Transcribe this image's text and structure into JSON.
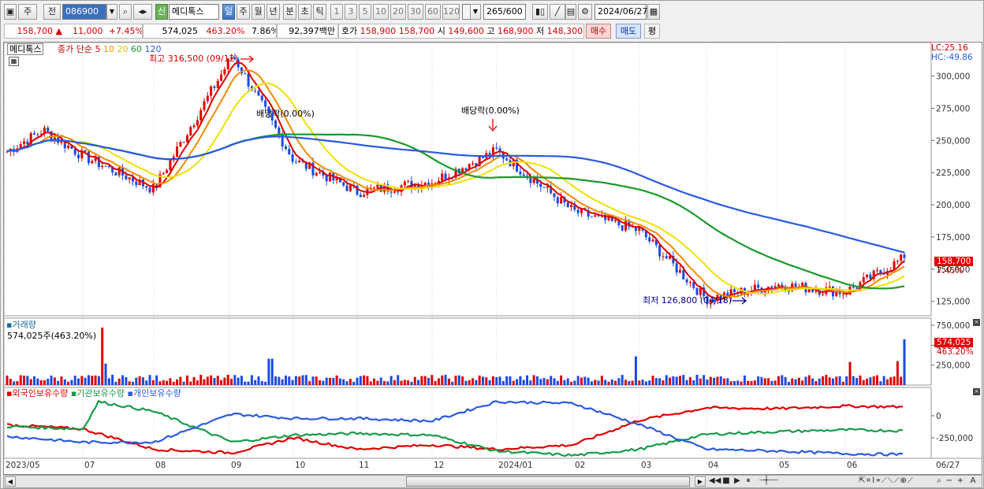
{
  "toolbar": {
    "market": "주",
    "prev": "전",
    "code": "086900",
    "shin": "신",
    "name": "메디톡스",
    "periods": [
      "일",
      "주",
      "월",
      "년",
      "분",
      "초",
      "틱"
    ],
    "active_period": "일",
    "intervals": [
      "1",
      "3",
      "5",
      "10",
      "20",
      "30",
      "60",
      "120"
    ],
    "count": "265",
    "count_max": "/600",
    "date": "2024/06/27"
  },
  "quote": {
    "price": "158,700",
    "arrow": "▲",
    "change": "11,000",
    "change_pct": "+7.45%",
    "volume": "574,025",
    "volume_pct": "463.20%",
    "turnover": "7.86%",
    "amount": "92,397백만",
    "bid_label": "호가",
    "bid": "158,900",
    "ask": "158,700",
    "open_label": "시",
    "open": "149,600",
    "high_label": "고",
    "high": "168,900",
    "low_label": "저",
    "low": "148,300",
    "buy": "매수",
    "sell": "매도",
    "flat": "평"
  },
  "chart_data": {
    "type": "line",
    "title": "메디톡스",
    "legend_price": "종가 단순 5 10 20 60 120",
    "ma_labels": [
      "5",
      "10",
      "20",
      "60",
      "120"
    ],
    "ma_colors": [
      "#e00000",
      "#f08c00",
      "#f0e000",
      "#1a9a2a",
      "#2a5ae0"
    ],
    "lc": "LC:25.16",
    "hc": "HC:-49.86",
    "y_ticks": [
      "300,000",
      "275,000",
      "250,000",
      "225,000",
      "200,000",
      "175,000",
      "150,000",
      "125,000"
    ],
    "ylim": [
      115000,
      320000
    ],
    "x_ticks": [
      "2023/05",
      "07",
      "08",
      "09",
      "10",
      "11",
      "12",
      "2024/01",
      "02",
      "03",
      "04",
      "05",
      "06",
      "06/27"
    ],
    "annotations": {
      "high": "최고 316,500 (09/12)",
      "low": "최저 126,800 (04/18)",
      "div1": "배당락(0.00%)",
      "div2": "배당락(0.00%)"
    },
    "last_price": "158,700",
    "last_pct": "7.45%",
    "price_points": [
      [
        "2023/05",
        240000
      ],
      [
        "2023/06",
        258000
      ],
      [
        "2023/07",
        238000
      ],
      [
        "2023/08",
        212000
      ],
      [
        "2023/09",
        316500
      ],
      [
        "2023/10",
        235000
      ],
      [
        "2023/11",
        210000
      ],
      [
        "2023/12",
        218000
      ],
      [
        "2024/01",
        242000
      ],
      [
        "2024/02",
        195000
      ],
      [
        "2024/03",
        180000
      ],
      [
        "2024/04",
        126800
      ],
      [
        "2024/05",
        138000
      ],
      [
        "2024/06",
        132000
      ],
      [
        "2024/06/27",
        158700
      ]
    ],
    "volume_panel": {
      "title": "거래량",
      "value": "574,025주(463.20%)",
      "y_ticks": [
        "750,000",
        "500,000",
        "250,000"
      ],
      "last": "574,025",
      "last_pct": "463.20%"
    },
    "holding_panel": {
      "series": [
        "외국인보유수량",
        "기관보유수량",
        "개인보유수량"
      ],
      "colors": [
        "#e00000",
        "#1a9a4a",
        "#2a5ae0"
      ],
      "y_ticks": [
        "0",
        "-250,000"
      ]
    }
  }
}
